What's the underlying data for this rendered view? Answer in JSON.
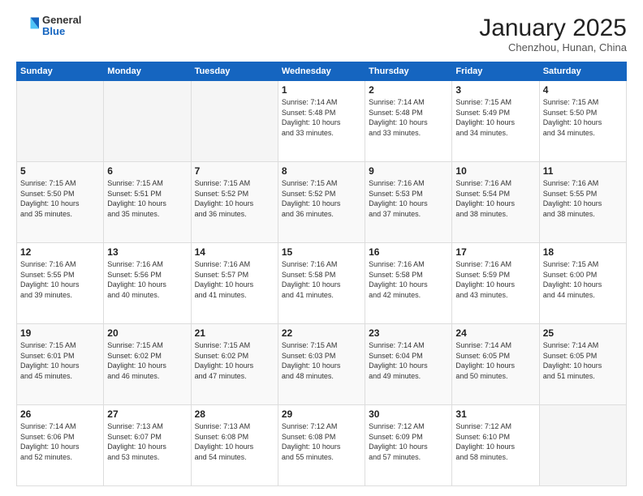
{
  "header": {
    "logo_general": "General",
    "logo_blue": "Blue",
    "month_title": "January 2025",
    "location": "Chenzhou, Hunan, China"
  },
  "calendar": {
    "days_of_week": [
      "Sunday",
      "Monday",
      "Tuesday",
      "Wednesday",
      "Thursday",
      "Friday",
      "Saturday"
    ],
    "weeks": [
      [
        {
          "day": "",
          "info": ""
        },
        {
          "day": "",
          "info": ""
        },
        {
          "day": "",
          "info": ""
        },
        {
          "day": "1",
          "info": "Sunrise: 7:14 AM\nSunset: 5:48 PM\nDaylight: 10 hours\nand 33 minutes."
        },
        {
          "day": "2",
          "info": "Sunrise: 7:14 AM\nSunset: 5:48 PM\nDaylight: 10 hours\nand 33 minutes."
        },
        {
          "day": "3",
          "info": "Sunrise: 7:15 AM\nSunset: 5:49 PM\nDaylight: 10 hours\nand 34 minutes."
        },
        {
          "day": "4",
          "info": "Sunrise: 7:15 AM\nSunset: 5:50 PM\nDaylight: 10 hours\nand 34 minutes."
        }
      ],
      [
        {
          "day": "5",
          "info": "Sunrise: 7:15 AM\nSunset: 5:50 PM\nDaylight: 10 hours\nand 35 minutes."
        },
        {
          "day": "6",
          "info": "Sunrise: 7:15 AM\nSunset: 5:51 PM\nDaylight: 10 hours\nand 35 minutes."
        },
        {
          "day": "7",
          "info": "Sunrise: 7:15 AM\nSunset: 5:52 PM\nDaylight: 10 hours\nand 36 minutes."
        },
        {
          "day": "8",
          "info": "Sunrise: 7:15 AM\nSunset: 5:52 PM\nDaylight: 10 hours\nand 36 minutes."
        },
        {
          "day": "9",
          "info": "Sunrise: 7:16 AM\nSunset: 5:53 PM\nDaylight: 10 hours\nand 37 minutes."
        },
        {
          "day": "10",
          "info": "Sunrise: 7:16 AM\nSunset: 5:54 PM\nDaylight: 10 hours\nand 38 minutes."
        },
        {
          "day": "11",
          "info": "Sunrise: 7:16 AM\nSunset: 5:55 PM\nDaylight: 10 hours\nand 38 minutes."
        }
      ],
      [
        {
          "day": "12",
          "info": "Sunrise: 7:16 AM\nSunset: 5:55 PM\nDaylight: 10 hours\nand 39 minutes."
        },
        {
          "day": "13",
          "info": "Sunrise: 7:16 AM\nSunset: 5:56 PM\nDaylight: 10 hours\nand 40 minutes."
        },
        {
          "day": "14",
          "info": "Sunrise: 7:16 AM\nSunset: 5:57 PM\nDaylight: 10 hours\nand 41 minutes."
        },
        {
          "day": "15",
          "info": "Sunrise: 7:16 AM\nSunset: 5:58 PM\nDaylight: 10 hours\nand 41 minutes."
        },
        {
          "day": "16",
          "info": "Sunrise: 7:16 AM\nSunset: 5:58 PM\nDaylight: 10 hours\nand 42 minutes."
        },
        {
          "day": "17",
          "info": "Sunrise: 7:16 AM\nSunset: 5:59 PM\nDaylight: 10 hours\nand 43 minutes."
        },
        {
          "day": "18",
          "info": "Sunrise: 7:15 AM\nSunset: 6:00 PM\nDaylight: 10 hours\nand 44 minutes."
        }
      ],
      [
        {
          "day": "19",
          "info": "Sunrise: 7:15 AM\nSunset: 6:01 PM\nDaylight: 10 hours\nand 45 minutes."
        },
        {
          "day": "20",
          "info": "Sunrise: 7:15 AM\nSunset: 6:02 PM\nDaylight: 10 hours\nand 46 minutes."
        },
        {
          "day": "21",
          "info": "Sunrise: 7:15 AM\nSunset: 6:02 PM\nDaylight: 10 hours\nand 47 minutes."
        },
        {
          "day": "22",
          "info": "Sunrise: 7:15 AM\nSunset: 6:03 PM\nDaylight: 10 hours\nand 48 minutes."
        },
        {
          "day": "23",
          "info": "Sunrise: 7:14 AM\nSunset: 6:04 PM\nDaylight: 10 hours\nand 49 minutes."
        },
        {
          "day": "24",
          "info": "Sunrise: 7:14 AM\nSunset: 6:05 PM\nDaylight: 10 hours\nand 50 minutes."
        },
        {
          "day": "25",
          "info": "Sunrise: 7:14 AM\nSunset: 6:05 PM\nDaylight: 10 hours\nand 51 minutes."
        }
      ],
      [
        {
          "day": "26",
          "info": "Sunrise: 7:14 AM\nSunset: 6:06 PM\nDaylight: 10 hours\nand 52 minutes."
        },
        {
          "day": "27",
          "info": "Sunrise: 7:13 AM\nSunset: 6:07 PM\nDaylight: 10 hours\nand 53 minutes."
        },
        {
          "day": "28",
          "info": "Sunrise: 7:13 AM\nSunset: 6:08 PM\nDaylight: 10 hours\nand 54 minutes."
        },
        {
          "day": "29",
          "info": "Sunrise: 7:12 AM\nSunset: 6:08 PM\nDaylight: 10 hours\nand 55 minutes."
        },
        {
          "day": "30",
          "info": "Sunrise: 7:12 AM\nSunset: 6:09 PM\nDaylight: 10 hours\nand 57 minutes."
        },
        {
          "day": "31",
          "info": "Sunrise: 7:12 AM\nSunset: 6:10 PM\nDaylight: 10 hours\nand 58 minutes."
        },
        {
          "day": "",
          "info": ""
        }
      ]
    ]
  }
}
